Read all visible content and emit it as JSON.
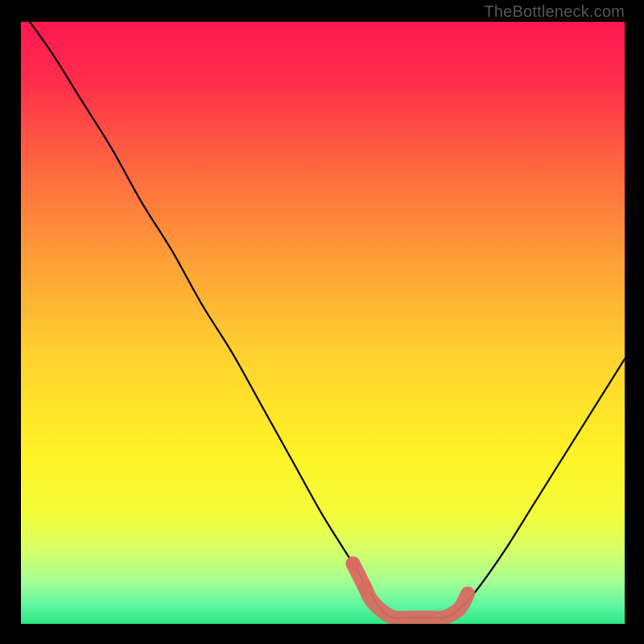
{
  "attribution": "TheBottleneck.com",
  "chart_data": {
    "type": "line",
    "title": "",
    "xlabel": "",
    "ylabel": "",
    "xlim": [
      0,
      100
    ],
    "ylim": [
      0,
      100
    ],
    "grid": false,
    "series": [
      {
        "name": "bottleneck-curve",
        "color": "#000000",
        "x": [
          0,
          5,
          10,
          15,
          20,
          25,
          30,
          35,
          40,
          45,
          50,
          55,
          58,
          60,
          62,
          65,
          68,
          70,
          72,
          75,
          80,
          85,
          90,
          95,
          100
        ],
        "values": [
          102,
          95,
          87,
          79,
          70,
          62,
          53,
          45,
          36,
          27,
          18,
          10,
          5,
          2,
          1,
          1,
          1,
          1,
          2,
          5,
          12,
          20,
          28,
          36,
          44
        ]
      }
    ],
    "highlight": {
      "name": "optimal-range",
      "color": "#d86b62",
      "x": [
        55,
        57,
        58,
        60,
        62,
        65,
        68,
        70,
        72,
        73,
        74
      ],
      "values": [
        10,
        6,
        4,
        2,
        1,
        1,
        1,
        1,
        2,
        3,
        5
      ]
    },
    "background_gradient": {
      "stops": [
        {
          "pos": 0.0,
          "color": "#ff1751"
        },
        {
          "pos": 0.1,
          "color": "#ff2d4a"
        },
        {
          "pos": 0.25,
          "color": "#ff6b3f"
        },
        {
          "pos": 0.4,
          "color": "#ffa038"
        },
        {
          "pos": 0.55,
          "color": "#ffd12f"
        },
        {
          "pos": 0.72,
          "color": "#fff326"
        },
        {
          "pos": 0.82,
          "color": "#f2fd3a"
        },
        {
          "pos": 0.88,
          "color": "#d4ff6a"
        },
        {
          "pos": 0.93,
          "color": "#a4ff94"
        },
        {
          "pos": 0.97,
          "color": "#5ef6a0"
        },
        {
          "pos": 1.0,
          "color": "#2de887"
        }
      ]
    }
  }
}
